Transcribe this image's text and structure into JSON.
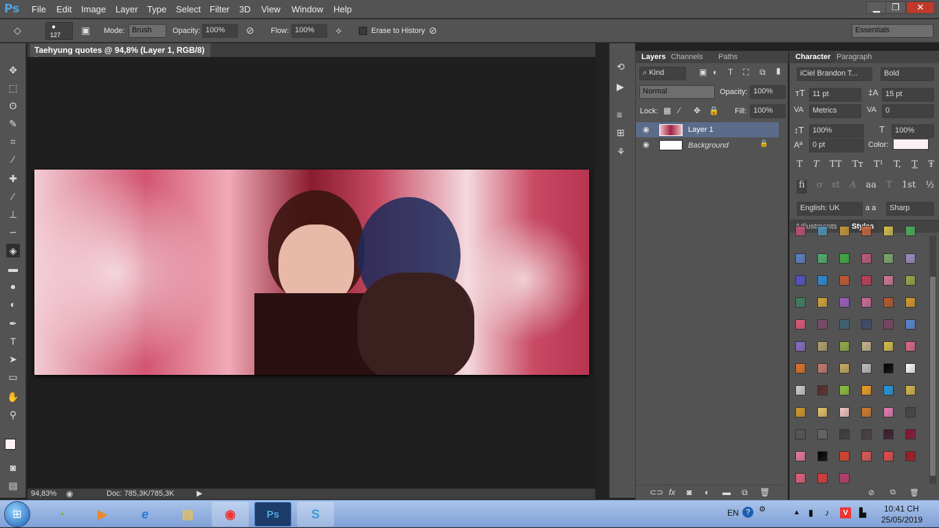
{
  "app": {
    "logo": "Ps"
  },
  "menu": [
    "File",
    "Edit",
    "Image",
    "Layer",
    "Type",
    "Select",
    "Filter",
    "3D",
    "View",
    "Window",
    "Help"
  ],
  "window_controls": [
    "▁",
    "❐",
    "✕"
  ],
  "options": {
    "brush_size": "127",
    "mode_label": "Mode:",
    "mode_value": "Brush",
    "opacity_label": "Opacity:",
    "opacity_value": "100%",
    "flow_label": "Flow:",
    "flow_value": "100%",
    "erase_history_label": "Erase to History",
    "workspace": "Essentials"
  },
  "document": {
    "tab_title": "Taehyung quotes @ 94,8% (Layer 1, RGB/8) *",
    "zoom": "94,83%",
    "doc_info": "Doc: 785,3K/785,3K"
  },
  "layers": {
    "tabs": [
      "Layers",
      "Channels",
      "Paths"
    ],
    "kind": "Kind",
    "blend": "Normal",
    "opacity_label": "Opacity:",
    "opacity_value": "100%",
    "lock_label": "Lock:",
    "fill_label": "Fill:",
    "fill_value": "100%",
    "items": [
      {
        "name": "Layer 1"
      },
      {
        "name": "Background"
      }
    ]
  },
  "character": {
    "tabs": [
      "Character",
      "Paragraph"
    ],
    "font_family": "iCiel Brandon T...",
    "font_style": "Bold",
    "size": "11 pt",
    "leading": "15 pt",
    "kerning": "Metrics",
    "tracking": "0",
    "vscale": "100%",
    "hscale": "100%",
    "baseline": "0 pt",
    "color_label": "Color:",
    "color_value": "#fdf0f2",
    "type_buttons": [
      "T",
      "T",
      "TT",
      "Tт",
      "T¹",
      "T,",
      "T",
      "Ŧ"
    ],
    "type_buttons2": [
      "fi",
      "ơ",
      "st",
      "A",
      "aa",
      "T",
      "1st",
      "½"
    ],
    "language": "English: UK",
    "aa_label": "a a",
    "antialias": "Sharp"
  },
  "styles": {
    "tabs": [
      "Adjustments",
      "Styles"
    ],
    "swatches": [
      "#c0507a",
      "#4e93b8",
      "#c79a3b",
      "#c9663d",
      "#d8c24e",
      "#4cae5b",
      "#5a82c8",
      "#50b070",
      "#3fae3f",
      "#c05a78",
      "#7fa96e",
      "#9d8cc2",
      "#5551c9",
      "#2c8ad8",
      "#c65a2e",
      "#c23d5c",
      "#d37798",
      "#9aa745",
      "#3f7f5c",
      "#d4a43c",
      "#9b5ec0",
      "#cf6b9b",
      "#b85a2a",
      "#d69a2a",
      "#e15a78",
      "#7a4b6a",
      "#3d6277",
      "#3c4a6e",
      "#7b4262",
      "#5a86d8",
      "#8a6ac8",
      "#b3a26e",
      "#8fb044",
      "#c9b48c",
      "#d6bf4a",
      "#e06688",
      "#e0722a",
      "#c47a6e",
      "#c9ac5e",
      "#bfbfbf",
      "#000000",
      "#ffffff",
      "#cfcfcf",
      "#5a2a2a",
      "#8cc43a",
      "#f0a020",
      "#1e9ae0",
      "#d7b84a",
      "#d49a2c",
      "#e8c26a",
      "#f4c6c6",
      "#d07c2a",
      "#e67ab4",
      "#444444",
      "#555555",
      "#666666",
      "#3a3a3a",
      "#4a3a42",
      "#3a1a2a",
      "#8a1030",
      "#e8789a",
      "#000000",
      "#e0402a",
      "#e05858",
      "#e84a4a",
      "#a01822",
      "#e6607a",
      "#e03a3a",
      "#c03a70"
    ]
  },
  "taskbar": {
    "lang": "EN",
    "time": "10:41 CH",
    "date": "25/05/2019"
  }
}
